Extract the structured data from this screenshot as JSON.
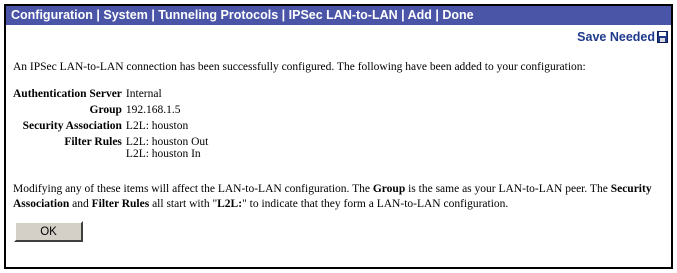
{
  "titlebar": {
    "breadcrumb": "Configuration | System | Tunneling Protocols | IPSec LAN-to-LAN | Add | Done"
  },
  "save": {
    "label": "Save Needed",
    "icon": "floppy-disk-icon"
  },
  "intro": "An IPSec LAN-to-LAN connection has been successfully configured. The following have been added to your configuration:",
  "details": {
    "auth_label": "Authentication Server",
    "auth_value": "Internal",
    "group_label": "Group",
    "group_value": "192.168.1.5",
    "sa_label": "Security Association",
    "sa_value": "L2L: houston",
    "filter_label": "Filter Rules",
    "filter_values": [
      "L2L: houston Out",
      "L2L: houston In"
    ]
  },
  "notes": {
    "p1": "Modifying any of these items will affect the LAN-to-LAN configuration. The ",
    "b1": "Group",
    "p2": " is the same as your LAN-to-LAN peer. The ",
    "b2": "Security Association",
    "p3": " and ",
    "b3": "Filter Rules",
    "p4": " all start with \"",
    "b4": "L2L:",
    "p5": "\" to indicate that they form a LAN-to-LAN configuration."
  },
  "buttons": {
    "ok": "OK"
  },
  "colors": {
    "titlebar_bg": "#4a55a8",
    "link": "#1f3a8a"
  }
}
